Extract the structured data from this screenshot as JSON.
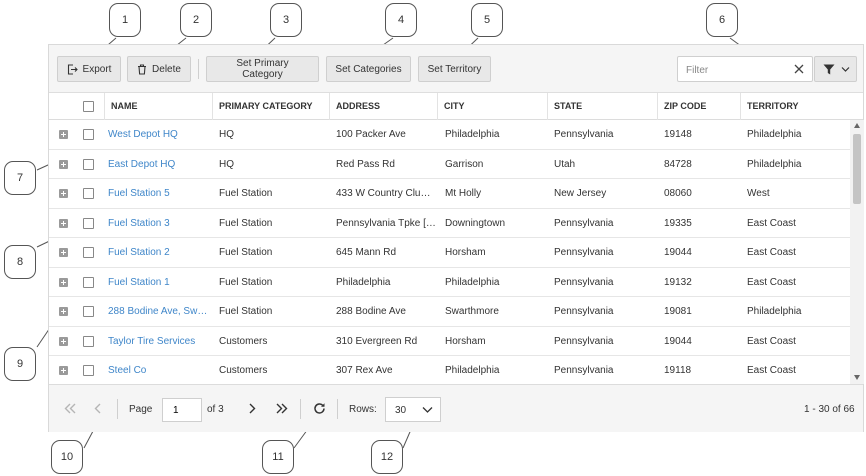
{
  "toolbar": {
    "export_label": "Export",
    "delete_label": "Delete",
    "set_primary_category_label": "Set Primary Category",
    "set_categories_label": "Set Categories",
    "set_territory_label": "Set Territory",
    "filter_placeholder": "Filter"
  },
  "columns": [
    "NAME",
    "PRIMARY CATEGORY",
    "ADDRESS",
    "CITY",
    "STATE",
    "ZIP CODE",
    "TERRITORY"
  ],
  "rows": [
    {
      "name": "West Depot HQ",
      "category": "HQ",
      "address": "100 Packer Ave",
      "city": "Philadelphia",
      "state": "Pennsylvania",
      "zip": "19148",
      "territory": "Philadelphia"
    },
    {
      "name": "East Depot HQ",
      "category": "HQ",
      "address": "Red Pass Rd",
      "city": "Garrison",
      "state": "Utah",
      "zip": "84728",
      "territory": "Philadelphia"
    },
    {
      "name": "Fuel Station 5",
      "category": "Fuel Station",
      "address": "433 W Country Club…",
      "city": "Mt Holly",
      "state": "New Jersey",
      "zip": "08060",
      "territory": "West"
    },
    {
      "name": "Fuel Station 3",
      "category": "Fuel Station",
      "address": "Pennsylvania Tpke […",
      "city": "Downingtown",
      "state": "Pennsylvania",
      "zip": "19335",
      "territory": "East Coast"
    },
    {
      "name": "Fuel Station 2",
      "category": "Fuel Station",
      "address": "645 Mann Rd",
      "city": "Horsham",
      "state": "Pennsylvania",
      "zip": "19044",
      "territory": "East Coast"
    },
    {
      "name": "Fuel Station 1",
      "category": "Fuel Station",
      "address": "Philadelphia",
      "city": "Philadelphia",
      "state": "Pennsylvania",
      "zip": "19132",
      "territory": "East Coast"
    },
    {
      "name": "288 Bodine Ave, Sw…",
      "category": "Fuel Station",
      "address": "288 Bodine Ave",
      "city": "Swarthmore",
      "state": "Pennsylvania",
      "zip": "19081",
      "territory": "Philadelphia"
    },
    {
      "name": "Taylor Tire Services",
      "category": "Customers",
      "address": "310 Evergreen Rd",
      "city": "Horsham",
      "state": "Pennsylvania",
      "zip": "19044",
      "territory": "East Coast"
    },
    {
      "name": "Steel Co",
      "category": "Customers",
      "address": "307 Rex Ave",
      "city": "Philadelphia",
      "state": "Pennsylvania",
      "zip": "19118",
      "territory": "East Coast"
    }
  ],
  "pager": {
    "page_label": "Page",
    "current_page": "1",
    "of_label": "of 3",
    "rows_label": "Rows:",
    "rows_value": "30",
    "range_text": "1 - 30 of 66"
  },
  "callouts": [
    "1",
    "2",
    "3",
    "4",
    "5",
    "6",
    "7",
    "8",
    "9",
    "10",
    "11",
    "12"
  ],
  "colors": {
    "link": "#3f86c9",
    "toolbar_bg": "#f5f5f5",
    "button_bg": "#e8e8e8"
  },
  "icons": [
    "export-icon",
    "trash-icon",
    "clear-icon",
    "filter-icon",
    "chevron-down-icon",
    "expand-plus-icon",
    "first-page-icon",
    "prev-page-icon",
    "next-page-icon",
    "last-page-icon",
    "refresh-icon"
  ]
}
